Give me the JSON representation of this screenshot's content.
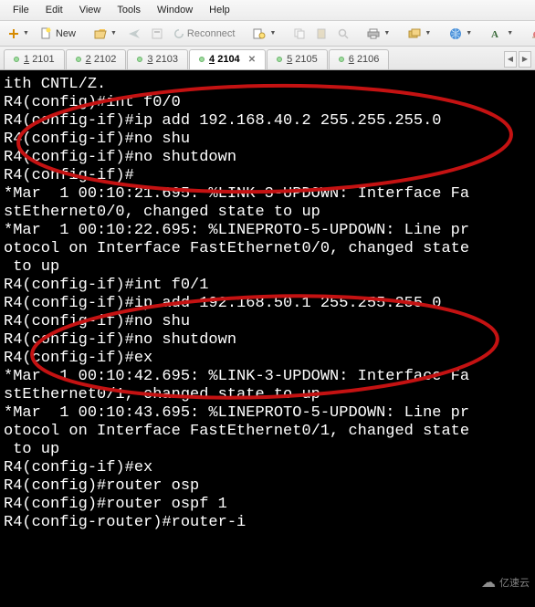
{
  "menubar": {
    "file": "File",
    "edit": "Edit",
    "view": "View",
    "tools": "Tools",
    "window": "Window",
    "help": "Help"
  },
  "toolbar": {
    "new_label": "New",
    "reconnect_label": "Reconnect"
  },
  "tabs": [
    {
      "hotkey": "1",
      "label": "2101"
    },
    {
      "hotkey": "2",
      "label": "2102"
    },
    {
      "hotkey": "3",
      "label": "2103"
    },
    {
      "hotkey": "4",
      "label": "2104"
    },
    {
      "hotkey": "5",
      "label": "2105"
    },
    {
      "hotkey": "6",
      "label": "2106"
    }
  ],
  "terminal_lines": [
    "ith CNTL/Z.",
    "R4(config)#int f0/0",
    "R4(config-if)#ip add 192.168.40.2 255.255.255.0",
    "R4(config-if)#no shu",
    "R4(config-if)#no shutdown",
    "R4(config-if)#",
    "*Mar  1 00:10:21.695: %LINK-3-UPDOWN: Interface Fa",
    "stEthernet0/0, changed state to up",
    "*Mar  1 00:10:22.695: %LINEPROTO-5-UPDOWN: Line pr",
    "otocol on Interface FastEthernet0/0, changed state",
    " to up",
    "R4(config-if)#int f0/1",
    "R4(config-if)#ip add 192.168.50.1 255.255.255.0",
    "R4(config-if)#no shu",
    "R4(config-if)#no shutdown",
    "R4(config-if)#ex",
    "*Mar  1 00:10:42.695: %LINK-3-UPDOWN: Interface Fa",
    "stEthernet0/1, changed state to up",
    "*Mar  1 00:10:43.695: %LINEPROTO-5-UPDOWN: Line pr",
    "otocol on Interface FastEthernet0/1, changed state",
    " to up",
    "R4(config-if)#ex",
    "R4(config)#router osp",
    "R4(config)#router ospf 1",
    "R4(config-router)#router-i"
  ],
  "watermark": "亿速云"
}
